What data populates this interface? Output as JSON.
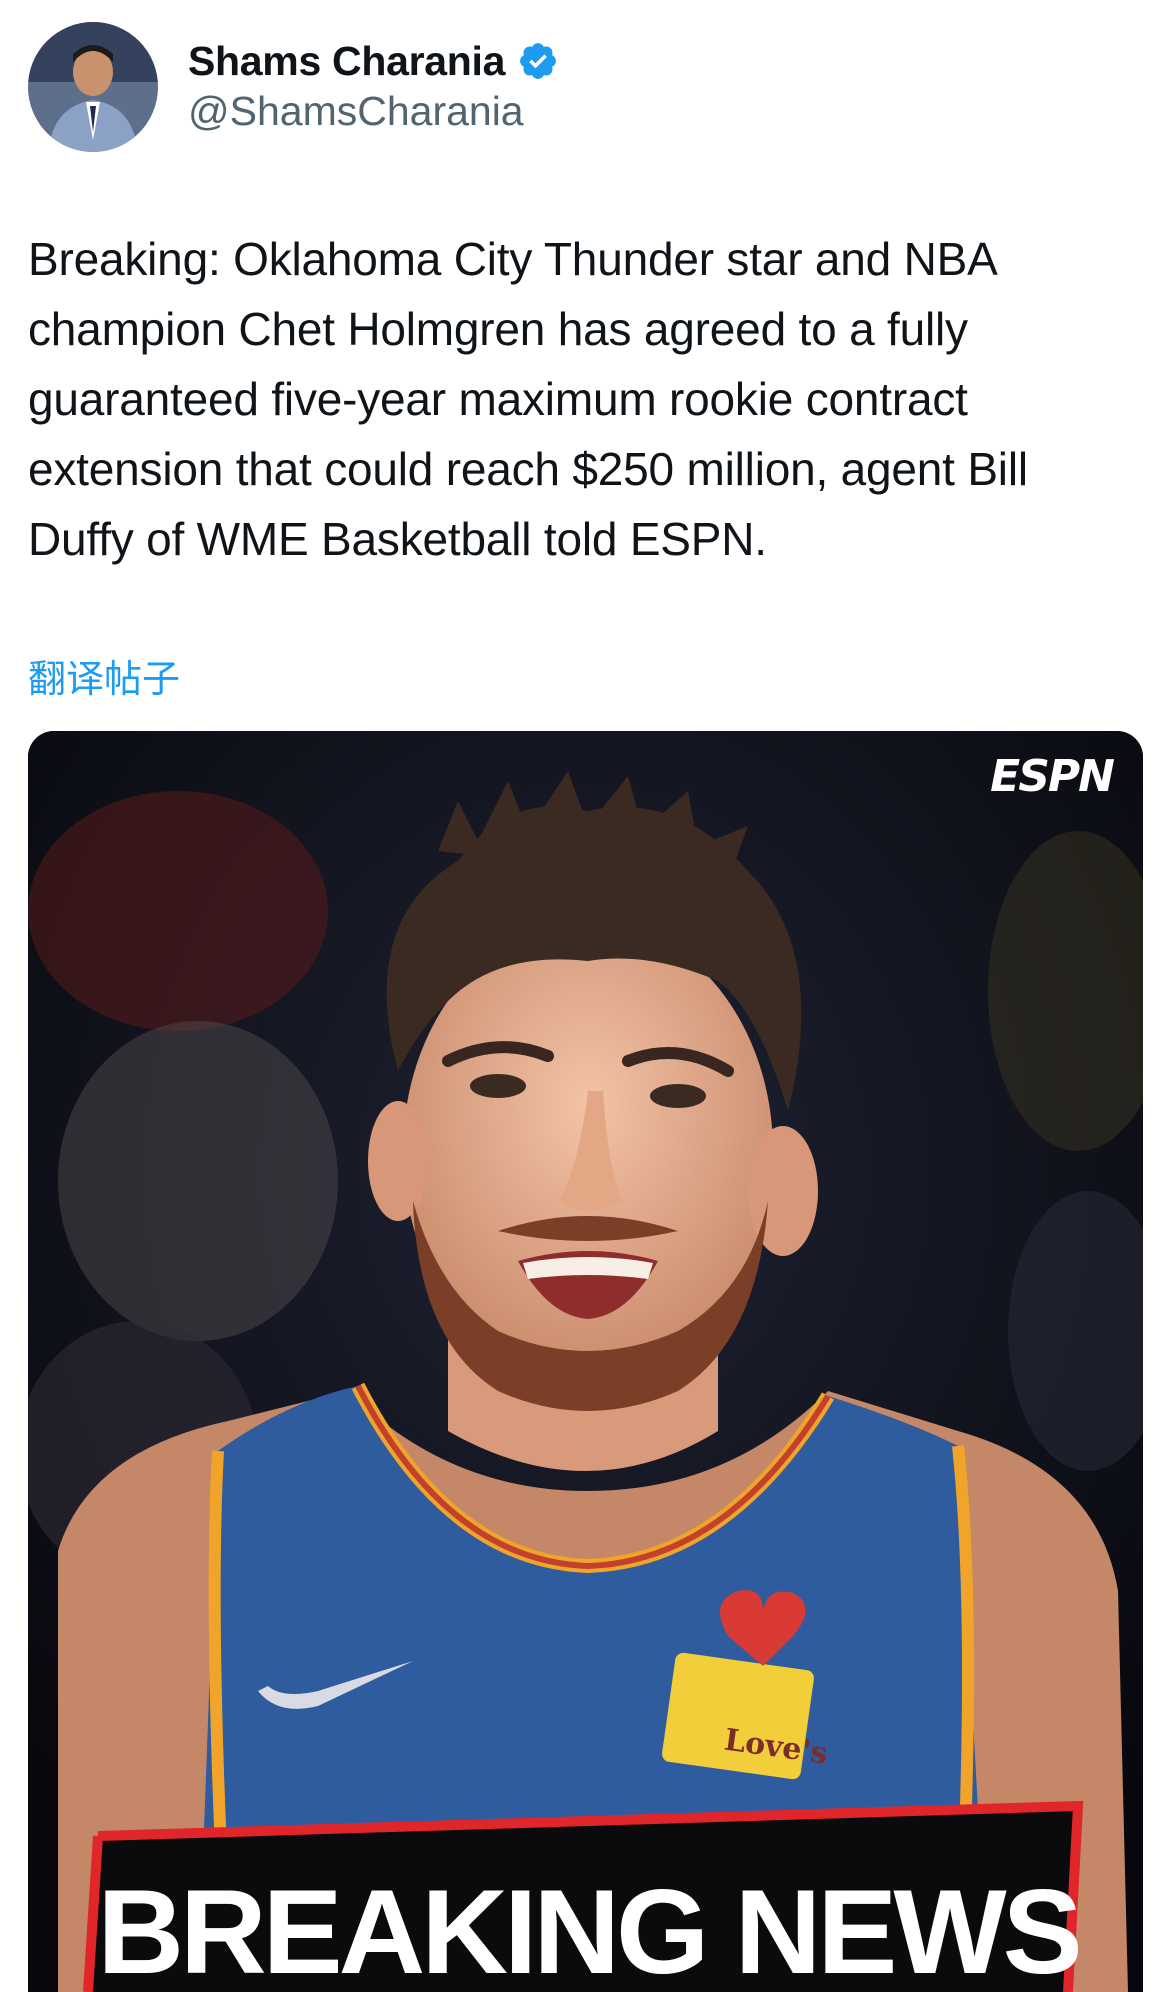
{
  "author": {
    "display_name": "Shams Charania",
    "handle": "@ShamsCharania",
    "verified": true,
    "verified_icon": "verified-badge-icon",
    "verified_color": "#1d9bf0"
  },
  "tweet": {
    "text": "Breaking: Oklahoma City Thunder star and NBA champion Chet Holmgren has agreed to a fully guaranteed five-year maximum rookie contract extension that could reach $250 million, agent Bill Duffy of WME Basketball told ESPN.",
    "translate_label": "翻译帖子"
  },
  "media": {
    "brand_logo_text": "ESPN",
    "banner_text": "BREAKING NEWS",
    "jersey_patch_text": "Love's",
    "banner_border_color": "#e0262b",
    "jersey_color": "#2f5c9e"
  }
}
